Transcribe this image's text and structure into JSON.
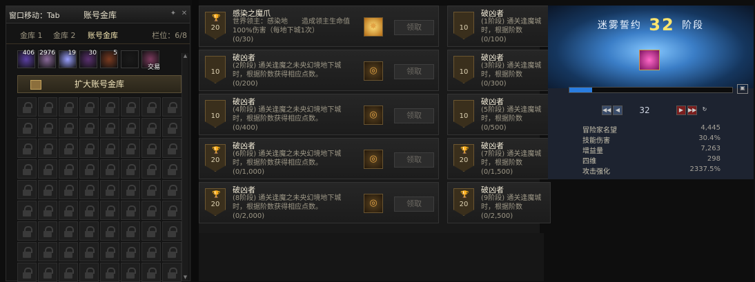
{
  "storage": {
    "hint": "窗口移动：Tab",
    "title": "账号金库",
    "tabs": [
      "金库 1",
      "金库 2",
      "账号金库"
    ],
    "slots_label": "栏位：6/8",
    "items": [
      {
        "name": "item-1",
        "count": "406",
        "color": "#5b3fa3"
      },
      {
        "name": "item-2",
        "count": "2976",
        "color": "#8a6a9a"
      },
      {
        "name": "item-3",
        "count": "19",
        "color": "#9aa0ff"
      },
      {
        "name": "item-4",
        "count": "30",
        "color": "#5a3070"
      },
      {
        "name": "item-5",
        "count": "5",
        "color": "#7a3a20"
      },
      {
        "name": "item-6",
        "count": "",
        "color": "#1a1a1a"
      },
      {
        "name": "item-7",
        "count": "",
        "color": "#7c3a5e"
      }
    ],
    "trade_label": "交易",
    "expand_button": "扩大账号金库"
  },
  "achievements": [
    {
      "title": "感染之魔爪",
      "desc": "世界领主：感染地　　造成领主生命值100%伤害（每地下城1次）",
      "progress": "(0/30)",
      "level": "20",
      "trophy": true,
      "reward_icon": "gold-star",
      "claim": "领取"
    },
    {
      "title": "破凶者",
      "desc": "(2阶段) 通关逢魔之未央幻境地下城时，根据阶数获得相应点数。",
      "progress": "(0/200)",
      "level": "10",
      "trophy": false,
      "reward_icon": "emblem",
      "claim": "领取"
    },
    {
      "title": "破凶者",
      "desc": "(4阶段) 通关逢魔之未央幻境地下城时，根据阶数获得相应点数。",
      "progress": "(0/400)",
      "level": "10",
      "trophy": false,
      "reward_icon": "emblem",
      "claim": "领取"
    },
    {
      "title": "破凶者",
      "desc": "(6阶段) 通关逢魔之未央幻境地下城时，根据阶数获得相应点数。",
      "progress": "(0/1,000)",
      "level": "20",
      "trophy": true,
      "reward_icon": "emblem",
      "claim": "领取"
    },
    {
      "title": "破凶者",
      "desc": "(8阶段) 通关逢魔之未央幻境地下城时，根据阶数获得相应点数。",
      "progress": "(0/2,000)",
      "level": "20",
      "trophy": true,
      "reward_icon": "emblem",
      "claim": "领取"
    }
  ],
  "achievements_right": [
    {
      "title": "破凶者",
      "desc": "(1阶段) 通关逢魔城时，根据阶数",
      "progress": "(0/100)",
      "level": "10",
      "trophy": false
    },
    {
      "title": "破凶者",
      "desc": "(3阶段) 通关逢魔城时，根据阶数",
      "progress": "(0/300)",
      "level": "10",
      "trophy": false
    },
    {
      "title": "破凶者",
      "desc": "(5阶段) 通关逢魔城时，根据阶数",
      "progress": "(0/500)",
      "level": "10",
      "trophy": false
    },
    {
      "title": "破凶者",
      "desc": "(7阶段) 通关逢魔城时，根据阶数",
      "progress": "(0/1,500)",
      "level": "20",
      "trophy": true
    },
    {
      "title": "破凶者",
      "desc": "(9阶段) 通关逢魔城时，根据阶数",
      "progress": "(0/2,500)",
      "level": "20",
      "trophy": true
    }
  ],
  "contract": {
    "title_prefix": "迷雾誓约",
    "stage": "32",
    "title_suffix": "阶段",
    "stage_value": "32",
    "progress_fraction": 0.14,
    "stats": [
      {
        "label": "冒险家名望",
        "value": "4,445"
      },
      {
        "label": "技能伤害",
        "value": "30.4%"
      },
      {
        "label": "增益量",
        "value": "7,263"
      },
      {
        "label": "四维",
        "value": "298"
      },
      {
        "label": "攻击强化",
        "value": "2337.5%"
      }
    ]
  }
}
